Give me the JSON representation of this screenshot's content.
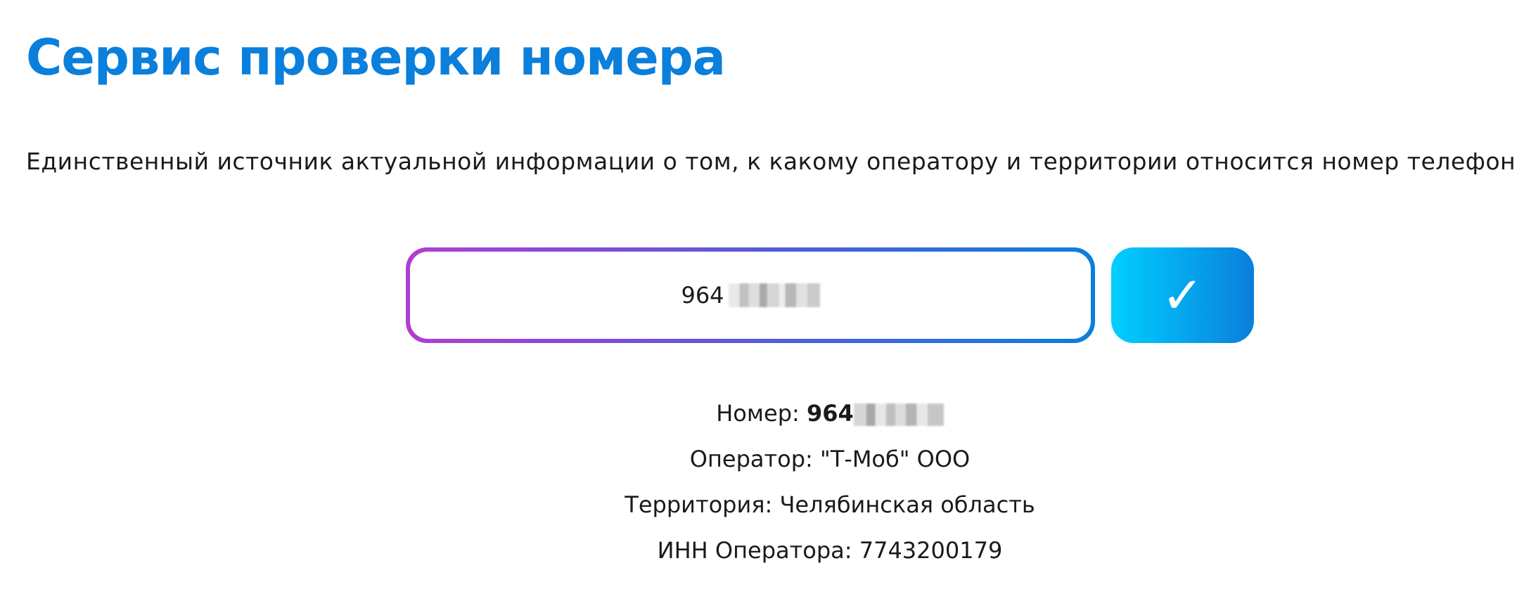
{
  "header": {
    "title": "Сервис проверки номера"
  },
  "intro": {
    "description": "Единственный источник актуальной информации о том, к какому оператору и территории относится номер телефона*."
  },
  "search": {
    "value_visible_prefix": "964",
    "value_masked": true,
    "submit_icon": "checkmark-icon",
    "submit_glyph": "✓",
    "border_gradient": [
      "#b03ed0",
      "#0a7fdc"
    ],
    "button_gradient": [
      "#00cfff",
      "#0a7fdc"
    ]
  },
  "results": {
    "number_label": "Номер: ",
    "number_value_prefix": "964",
    "operator": "Оператор: \"Т-Моб\" ООО",
    "territory": "Территория: Челябинская область",
    "inn": "ИНН Оператора: 7743200179"
  },
  "colors": {
    "title": "#0a7fdc",
    "text": "#1a1a1a",
    "background": "#ffffff"
  }
}
